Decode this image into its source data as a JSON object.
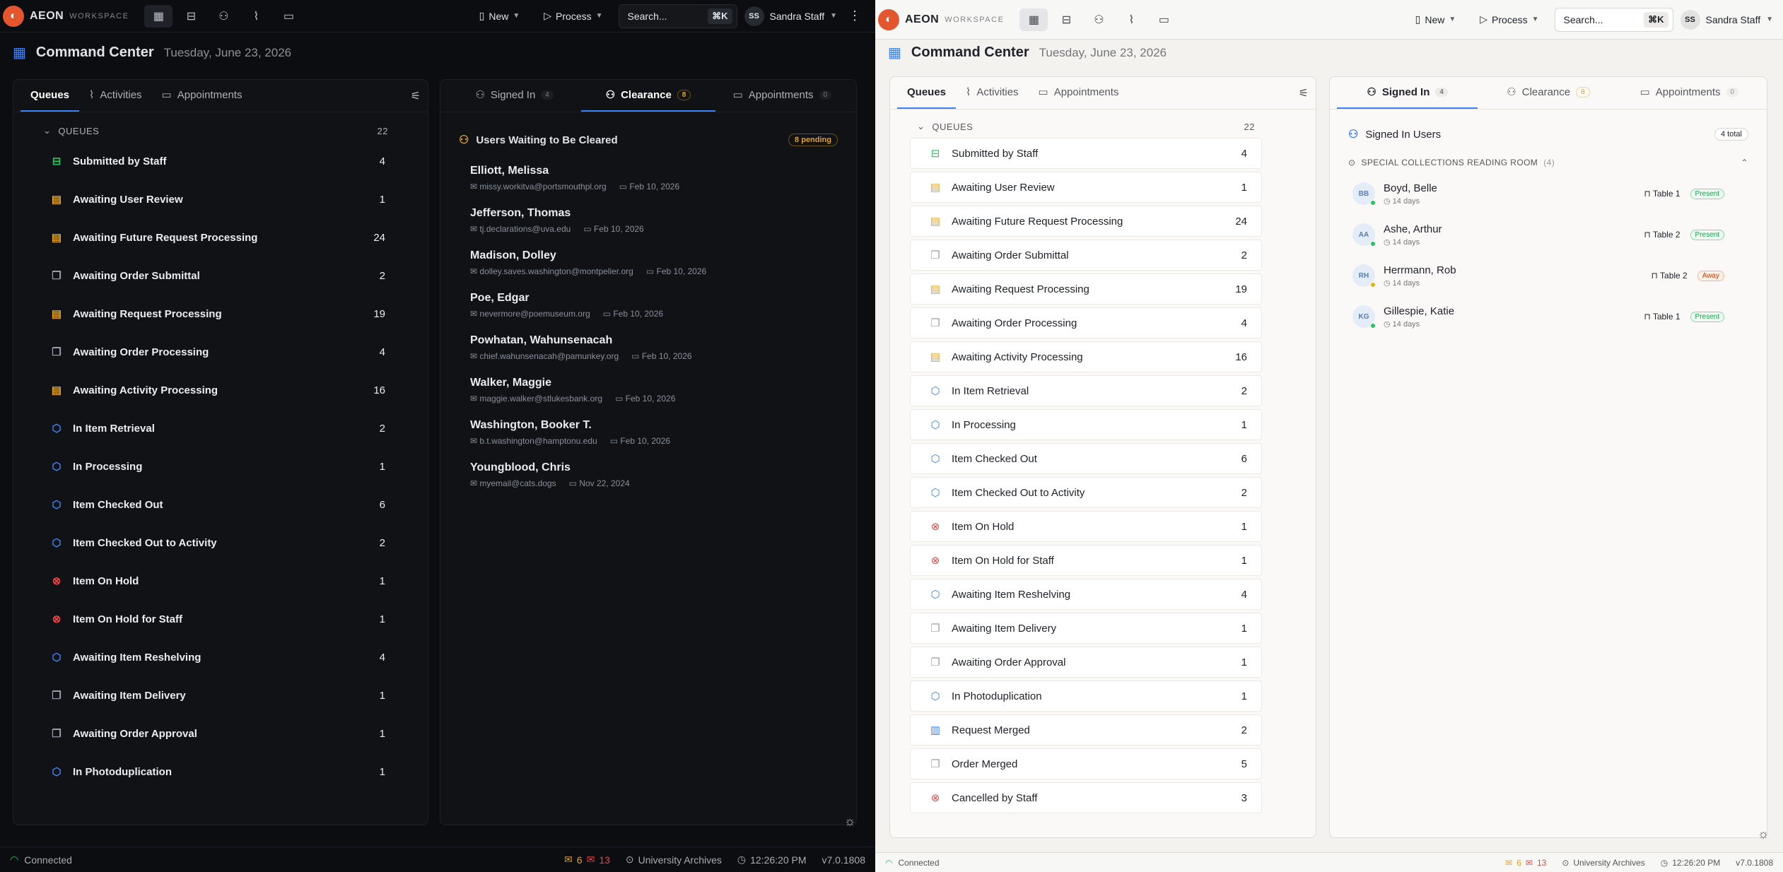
{
  "app": {
    "name": "AEON",
    "workspace": "WORKSPACE"
  },
  "topbar": {
    "new_label": "New",
    "process_label": "Process",
    "search_placeholder": "Search...",
    "search_shortcut": "⌘K",
    "user_initials": "SS",
    "user_name": "Sandra Staff"
  },
  "page": {
    "title": "Command Center",
    "date": "Tuesday, June 23, 2026"
  },
  "left_tabs": [
    {
      "label": "Queues"
    },
    {
      "label": "Activities"
    },
    {
      "label": "Appointments"
    }
  ],
  "right_tabs": [
    {
      "label": "Signed In",
      "badge": "4"
    },
    {
      "label": "Clearance",
      "badge": "8"
    },
    {
      "label": "Appointments",
      "badge": "0"
    }
  ],
  "queues_header": {
    "label": "QUEUES",
    "count": "22"
  },
  "queues": [
    {
      "label": "Submitted by Staff",
      "count": "4",
      "icon": "inbox-icon",
      "color": "green"
    },
    {
      "label": "Awaiting User Review",
      "count": "1",
      "icon": "clipboard-icon",
      "color": "amber"
    },
    {
      "label": "Awaiting Future Request Processing",
      "count": "24",
      "icon": "clipboard-icon",
      "color": "amber"
    },
    {
      "label": "Awaiting Order Submittal",
      "count": "2",
      "icon": "copy-icon",
      "color": "grey"
    },
    {
      "label": "Awaiting Request Processing",
      "count": "19",
      "icon": "clipboard-icon",
      "color": "amber"
    },
    {
      "label": "Awaiting Order Processing",
      "count": "4",
      "icon": "copy-icon",
      "color": "grey"
    },
    {
      "label": "Awaiting Activity Processing",
      "count": "16",
      "icon": "clipboard-icon",
      "color": "amber"
    },
    {
      "label": "In Item Retrieval",
      "count": "2",
      "icon": "box-icon",
      "color": "blue"
    },
    {
      "label": "In Processing",
      "count": "1",
      "icon": "box-icon",
      "color": "blue"
    },
    {
      "label": "Item Checked Out",
      "count": "6",
      "icon": "box-icon",
      "color": "blue"
    },
    {
      "label": "Item Checked Out to Activity",
      "count": "2",
      "icon": "box-icon",
      "color": "blue"
    },
    {
      "label": "Item On Hold",
      "count": "1",
      "icon": "x-circle-icon",
      "color": "red"
    },
    {
      "label": "Item On Hold for Staff",
      "count": "1",
      "icon": "x-circle-icon",
      "color": "red"
    },
    {
      "label": "Awaiting Item Reshelving",
      "count": "4",
      "icon": "box-icon",
      "color": "blue"
    },
    {
      "label": "Awaiting Item Delivery",
      "count": "1",
      "icon": "copy-icon",
      "color": "grey"
    },
    {
      "label": "Awaiting Order Approval",
      "count": "1",
      "icon": "copy-icon",
      "color": "grey"
    },
    {
      "label": "In Photoduplication",
      "count": "1",
      "icon": "box-icon",
      "color": "blue"
    },
    {
      "label": "Request Merged",
      "count": "2",
      "icon": "book-icon",
      "color": "blue"
    },
    {
      "label": "Order Merged",
      "count": "5",
      "icon": "copy-icon",
      "color": "grey"
    },
    {
      "label": "Cancelled by Staff",
      "count": "3",
      "icon": "x-circle-icon",
      "color": "red"
    }
  ],
  "clearance": {
    "title": "Users Waiting to Be Cleared",
    "pending": "8 pending",
    "users": [
      {
        "name": "Elliott, Melissa",
        "email": "missy.workitva@portsmouthpl.org",
        "date": "Feb 10, 2026"
      },
      {
        "name": "Jefferson, Thomas",
        "email": "tj.declarations@uva.edu",
        "date": "Feb 10, 2026"
      },
      {
        "name": "Madison, Dolley",
        "email": "dolley.saves.washington@montpelier.org",
        "date": "Feb 10, 2026"
      },
      {
        "name": "Poe, Edgar",
        "email": "nevermore@poemuseum.org",
        "date": "Feb 10, 2026"
      },
      {
        "name": "Powhatan, Wahunsenacah",
        "email": "chief.wahunsenacah@pamunkey.org",
        "date": "Feb 10, 2026"
      },
      {
        "name": "Walker, Maggie",
        "email": "maggie.walker@stlukesbank.org",
        "date": "Feb 10, 2026"
      },
      {
        "name": "Washington, Booker T.",
        "email": "b.t.washington@hamptonu.edu",
        "date": "Feb 10, 2026"
      },
      {
        "name": "Youngblood, Chris",
        "email": "myemail@cats.dogs",
        "date": "Nov 22, 2024"
      }
    ]
  },
  "signed_in": {
    "title": "Signed In Users",
    "total": "4 total",
    "room": "SPECIAL COLLECTIONS READING ROOM",
    "room_count": "(4)",
    "users": [
      {
        "initials": "BB",
        "name": "Boyd, Belle",
        "time": "14 days",
        "table": "Table 1",
        "status": "Present",
        "dot": "#22c55e"
      },
      {
        "initials": "AA",
        "name": "Ashe, Arthur",
        "time": "14 days",
        "table": "Table 2",
        "status": "Present",
        "dot": "#22c55e"
      },
      {
        "initials": "RH",
        "name": "Herrmann, Rob",
        "time": "14 days",
        "table": "Table 2",
        "status": "Away",
        "dot": "#eab308"
      },
      {
        "initials": "KG",
        "name": "Gillespie, Katie",
        "time": "14 days",
        "table": "Table 1",
        "status": "Present",
        "dot": "#22c55e"
      }
    ]
  },
  "footer": {
    "status": "Connected",
    "mail_orange": "6",
    "mail_red": "13",
    "location": "University Archives",
    "time": "12:26:20 PM",
    "version": "v7.0.1808"
  }
}
